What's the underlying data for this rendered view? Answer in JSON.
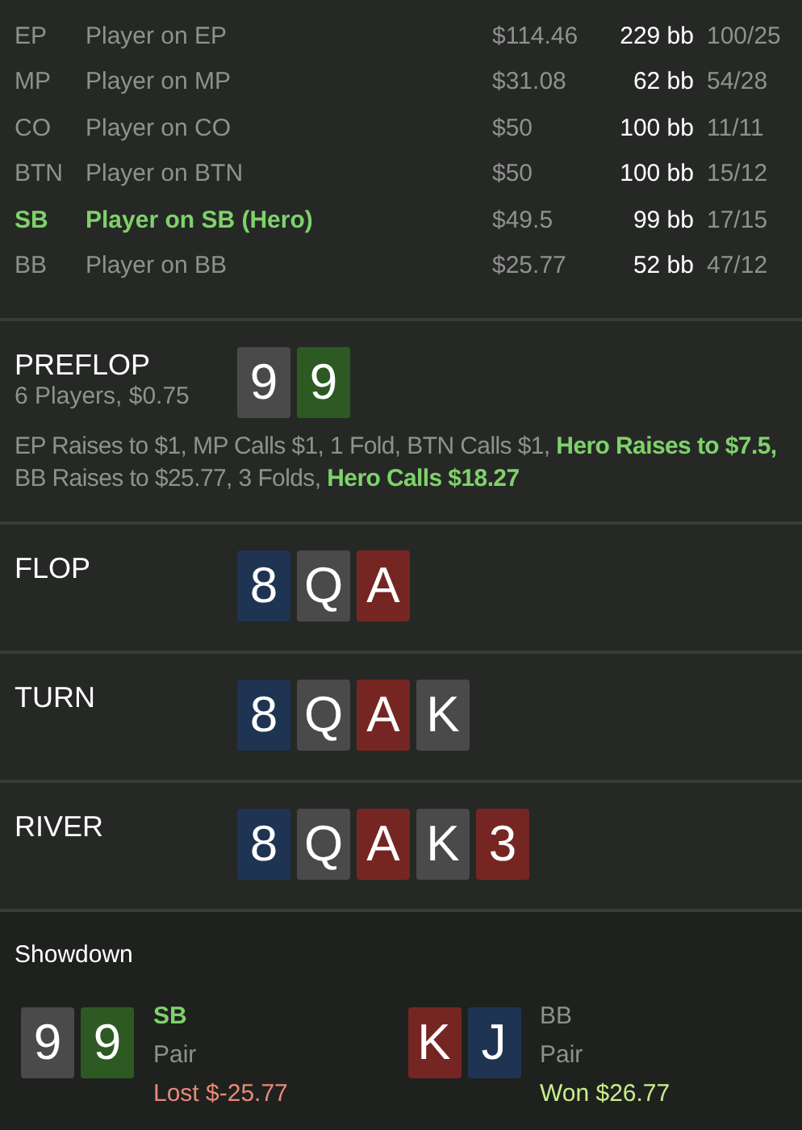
{
  "players": [
    {
      "position": "EP",
      "name": "Player on EP",
      "stack": "$114.46",
      "bb": "229 bb",
      "stats": "100/25",
      "hero": false
    },
    {
      "position": "MP",
      "name": "Player on MP",
      "stack": "$31.08",
      "bb": "62 bb",
      "stats": "54/28",
      "hero": false
    },
    {
      "position": "CO",
      "name": "Player on CO",
      "stack": "$50",
      "bb": "100 bb",
      "stats": "11/11",
      "hero": false
    },
    {
      "position": "BTN",
      "name": "Player on BTN",
      "stack": "$50",
      "bb": "100 bb",
      "stats": "15/12",
      "hero": false
    },
    {
      "position": "SB",
      "name": "Player on SB (Hero)",
      "stack": "$49.5",
      "bb": "99 bb",
      "stats": "17/15",
      "hero": true
    },
    {
      "position": "BB",
      "name": "Player on BB",
      "stack": "$25.77",
      "bb": "52 bb",
      "stats": "47/12",
      "hero": false
    }
  ],
  "streets": [
    {
      "name": "PREFLOP",
      "info": "6 Players, $0.75",
      "cards": [
        {
          "rank": "9",
          "color": "#4a4a4a"
        },
        {
          "rank": "9",
          "color": "#2d5a22"
        }
      ],
      "actions": "EP Raises to $1, MP Calls $1, 1 Fold, BTN Calls $1, **Hero Raises to $7.5,** BB Raises to $25.77, 3 Folds, **Hero Calls $18.27**"
    },
    {
      "name": "FLOP",
      "cards": [
        {
          "rank": "8",
          "color": "#1e3452"
        },
        {
          "rank": "Q",
          "color": "#4a4a4a"
        },
        {
          "rank": "A",
          "color": "#762622"
        }
      ]
    },
    {
      "name": "TURN",
      "cards": [
        {
          "rank": "8",
          "color": "#1e3452"
        },
        {
          "rank": "Q",
          "color": "#4a4a4a"
        },
        {
          "rank": "A",
          "color": "#762622"
        },
        {
          "rank": "K",
          "color": "#4a4a4a"
        }
      ]
    },
    {
      "name": "RIVER",
      "cards": [
        {
          "rank": "8",
          "color": "#1e3452"
        },
        {
          "rank": "Q",
          "color": "#4a4a4a"
        },
        {
          "rank": "A",
          "color": "#762622"
        },
        {
          "rank": "K",
          "color": "#4a4a4a"
        },
        {
          "rank": "3",
          "color": "#762622"
        }
      ]
    }
  ],
  "showdown": {
    "title": "Showdown",
    "hands": [
      {
        "position": "SB",
        "hero": true,
        "cards": [
          {
            "rank": "9",
            "color": "#4a4a4a"
          },
          {
            "rank": "9",
            "color": "#2d5a22"
          }
        ],
        "hand": "Pair",
        "result": "Lost $-25.77",
        "kind": "lost"
      },
      {
        "position": "BB",
        "hero": false,
        "cards": [
          {
            "rank": "K",
            "color": "#762622"
          },
          {
            "rank": "J",
            "color": "#1e3452"
          }
        ],
        "hand": "Pair",
        "result": "Won $26.77",
        "kind": "won"
      }
    ]
  }
}
